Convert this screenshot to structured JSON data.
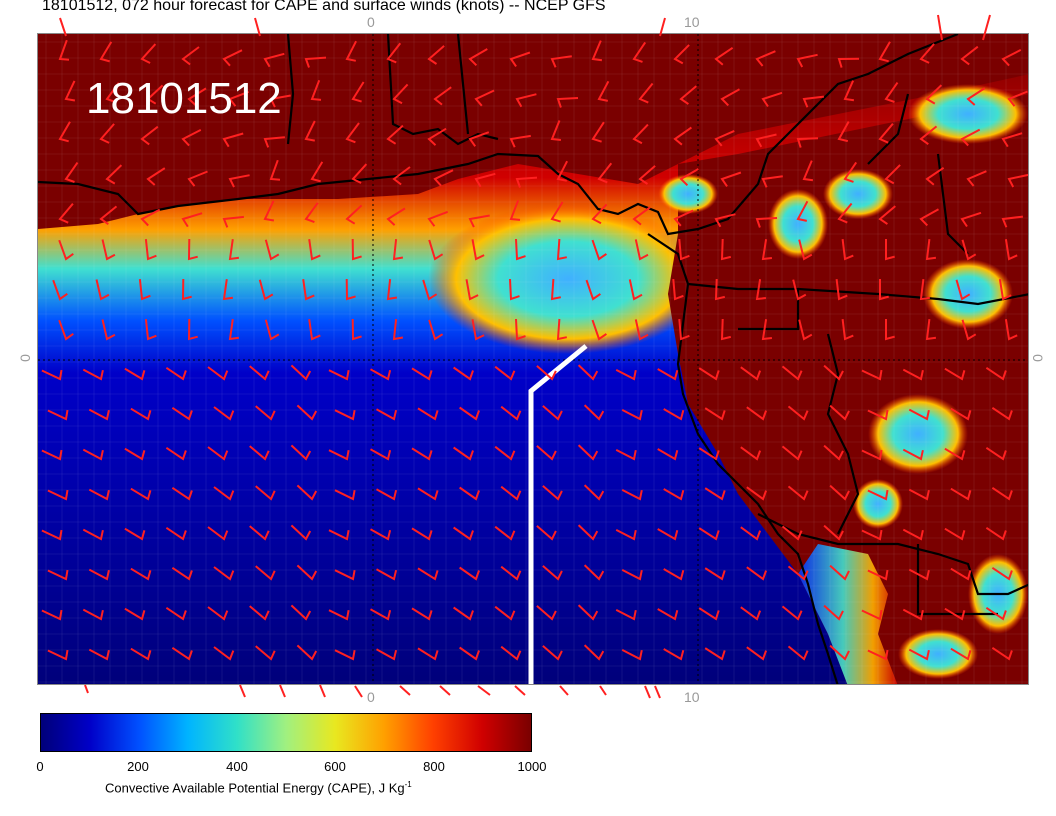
{
  "page": {
    "title": "18101512, 072 hour forecast for CAPE and surface winds (knots) -- NCEP GFS",
    "datetime_label": "18101512"
  },
  "map": {
    "lon_ticks": [
      "0",
      "10"
    ],
    "lat_ticks": [
      "0"
    ],
    "variable": "Convective Available Potential Energy (CAPE)",
    "wind_units": "knots",
    "model": "NCEP GFS",
    "colors": {
      "low": "#00008b",
      "mid": "#40e0d0",
      "high": "#7a0000",
      "barb": "#ff2020",
      "coast": "#000000",
      "transect": "#ffffff"
    }
  },
  "colorbar": {
    "ticks": [
      "0",
      "200",
      "400",
      "600",
      "800",
      "1000"
    ],
    "label": "Convective Available Potential Energy (CAPE), J Kg",
    "label_sup": "-1",
    "min": 0,
    "max": 1000,
    "stops": [
      "#00007a",
      "#0000c8",
      "#0050ff",
      "#00b4ff",
      "#30e0c8",
      "#a0f080",
      "#e8e820",
      "#ffa000",
      "#ff4000",
      "#d00000",
      "#7a0000"
    ]
  }
}
